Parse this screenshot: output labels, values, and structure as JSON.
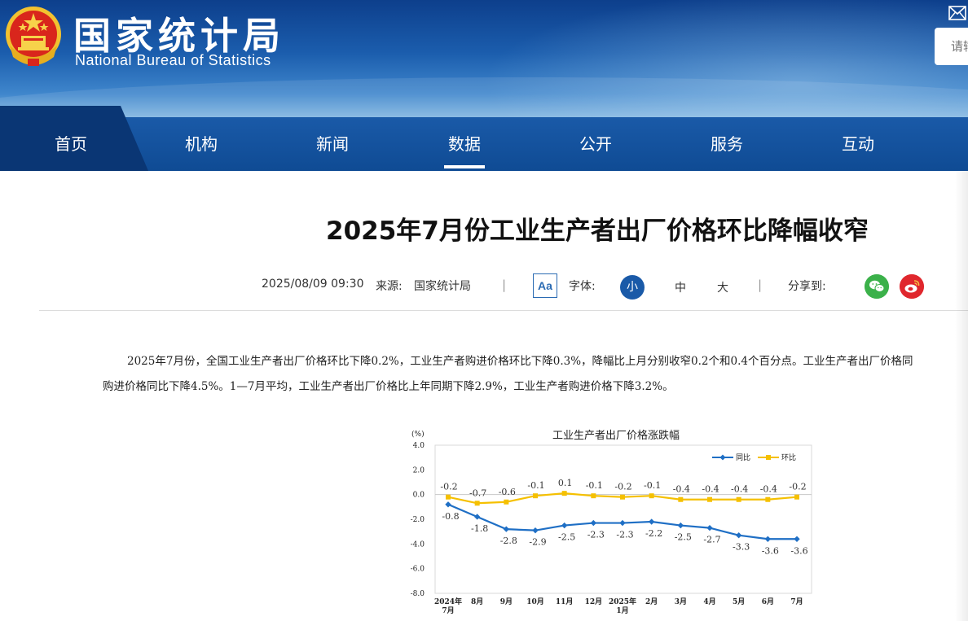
{
  "site": {
    "title_cn": "国家统计局",
    "title_en": "National Bureau of Statistics",
    "search_placeholder": "请输"
  },
  "nav": {
    "items": [
      "首页",
      "机构",
      "新闻",
      "数据",
      "公开",
      "服务",
      "互动"
    ],
    "active_index": 3
  },
  "article": {
    "title": "2025年7月份工业生产者出厂价格环比降幅收窄",
    "datetime": "2025/08/09 09:30",
    "source_label": "来源:",
    "source": "国家统计局",
    "aa_label": "Aa",
    "font_label": "字体:",
    "font_sizes": [
      "小",
      "中",
      "大"
    ],
    "share_label": "分享到:",
    "paragraph_line1": "2025年7月份，全国工业生产者出厂价格环比下降0.2%，工业生产者购进价格环比下降0.3%，降幅比上月分别收窄0.2个和0.4个百分点。工业生产者出厂价格同",
    "paragraph_line2": "购进价格同比下降4.5%。1—7月平均，工业生产者出厂价格比上年同期下降2.9%，工业生产者购进价格下降3.2%。"
  },
  "colors": {
    "brand_blue": "#1a5aa8",
    "series_yoy": "#1f6fc5",
    "series_mom": "#f5c000"
  },
  "chart_data": {
    "type": "line",
    "title": "工业生产者出厂价格涨跌幅",
    "ylabel": "(%)",
    "ylim": [
      -8.0,
      4.0
    ],
    "yticks": [
      "4.0",
      "2.0",
      "0.0",
      "-2.0",
      "-4.0",
      "-6.0",
      "-8.0"
    ],
    "categories": [
      "2024年7月",
      "8月",
      "9月",
      "10月",
      "11月",
      "12月",
      "2025年1月",
      "2月",
      "3月",
      "4月",
      "5月",
      "6月",
      "7月"
    ],
    "category_lines": [
      [
        "2024年",
        "7月"
      ],
      [
        "8月"
      ],
      [
        "9月"
      ],
      [
        "10月"
      ],
      [
        "11月"
      ],
      [
        "12月"
      ],
      [
        "2025年",
        "1月"
      ],
      [
        "2月"
      ],
      [
        "3月"
      ],
      [
        "4月"
      ],
      [
        "5月"
      ],
      [
        "6月"
      ],
      [
        "7月"
      ]
    ],
    "legend_position": "top-right",
    "series": [
      {
        "name": "同比",
        "values": [
          -0.8,
          -1.8,
          -2.8,
          -2.9,
          -2.5,
          -2.3,
          -2.3,
          -2.2,
          -2.5,
          -2.7,
          -3.3,
          -3.6,
          -3.6
        ],
        "labels": [
          "-0.8",
          "-1.8",
          "-2.8",
          "-2.9",
          "-2.5",
          "-2.3",
          "-2.3",
          "-2.2",
          "-2.5",
          "-2.7",
          "-3.3",
          "-3.6",
          "-3.6"
        ]
      },
      {
        "name": "环比",
        "values": [
          -0.2,
          -0.7,
          -0.6,
          -0.1,
          0.1,
          -0.1,
          -0.2,
          -0.1,
          -0.4,
          -0.4,
          -0.4,
          -0.4,
          -0.2
        ],
        "labels": [
          "-0.2",
          "-0.7",
          "-0.6",
          "-0.1",
          "0.1",
          "-0.1",
          "-0.2",
          "-0.1",
          "-0.4",
          "-0.4",
          "-0.4",
          "-0.4",
          "-0.2"
        ]
      }
    ]
  }
}
